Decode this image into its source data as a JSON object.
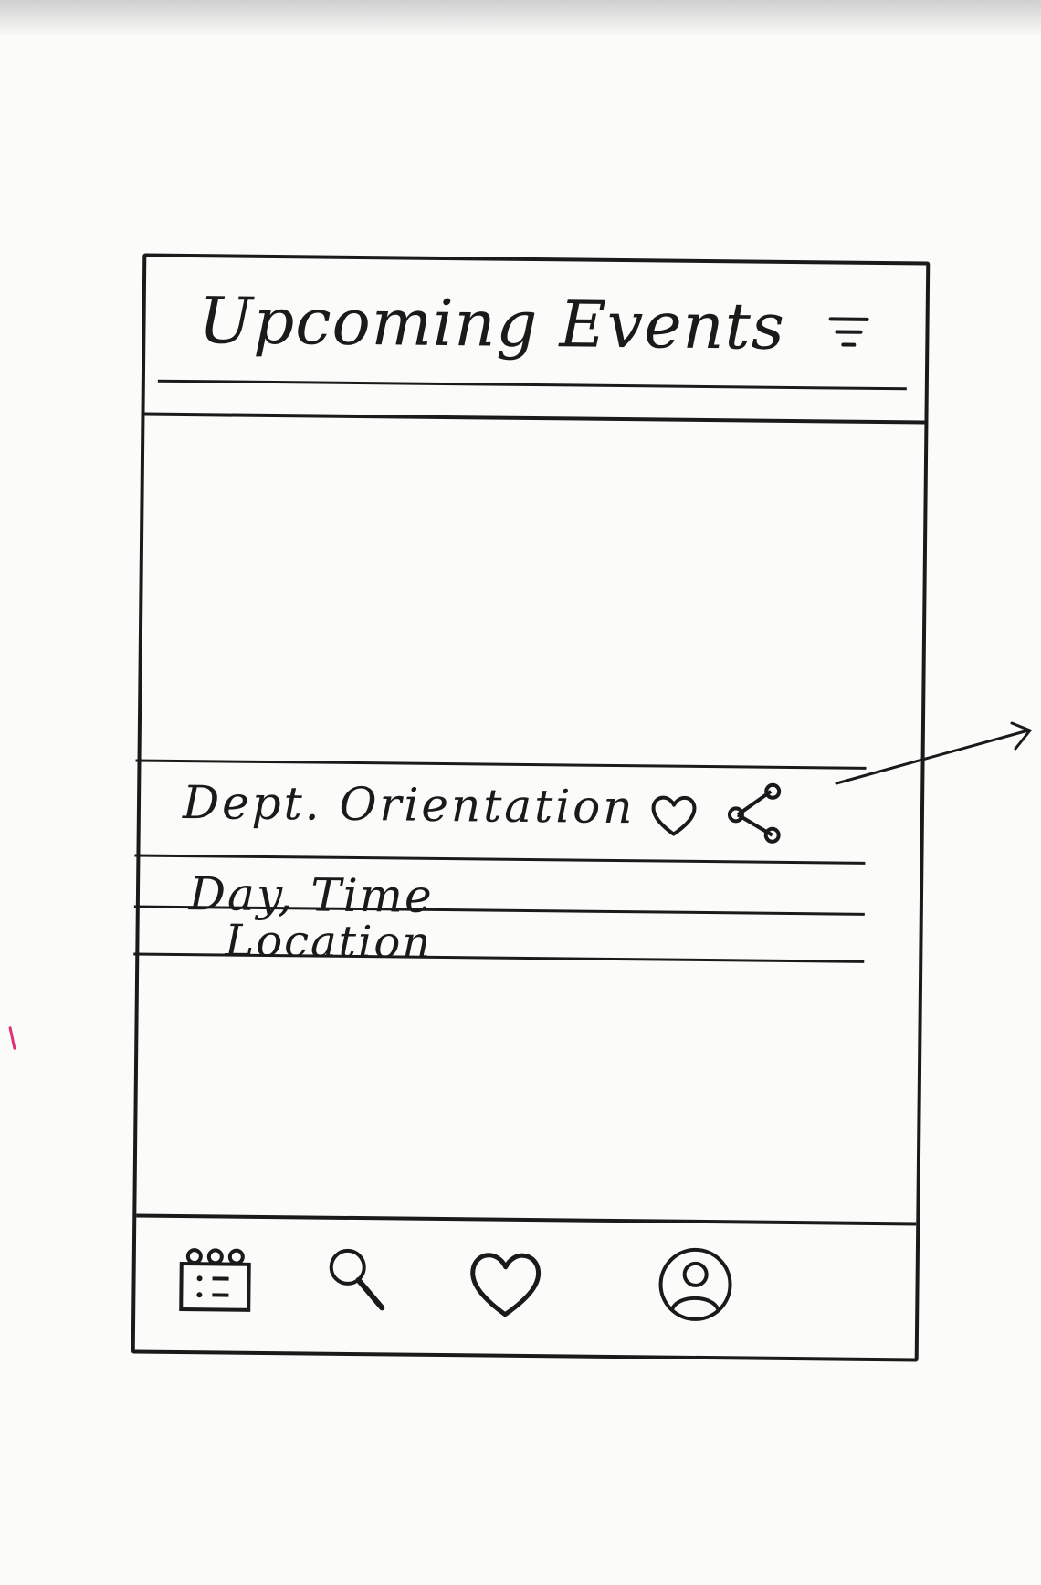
{
  "header": {
    "title": "Upcoming Events",
    "filter_icon": "filter-icon"
  },
  "event": {
    "title": "Dept. Orientation",
    "day_time": "Day, Time",
    "location": "Location",
    "like_icon": "heart-icon",
    "share_icon": "share-icon"
  },
  "tab_bar": {
    "tabs": [
      {
        "icon": "calendar-icon"
      },
      {
        "icon": "search-icon"
      },
      {
        "icon": "heart-icon"
      },
      {
        "icon": "profile-icon"
      }
    ]
  },
  "colors": {
    "ink": "#1a1a1a",
    "paper": "#fbfbfa",
    "margin_mark": "#e0307a"
  }
}
